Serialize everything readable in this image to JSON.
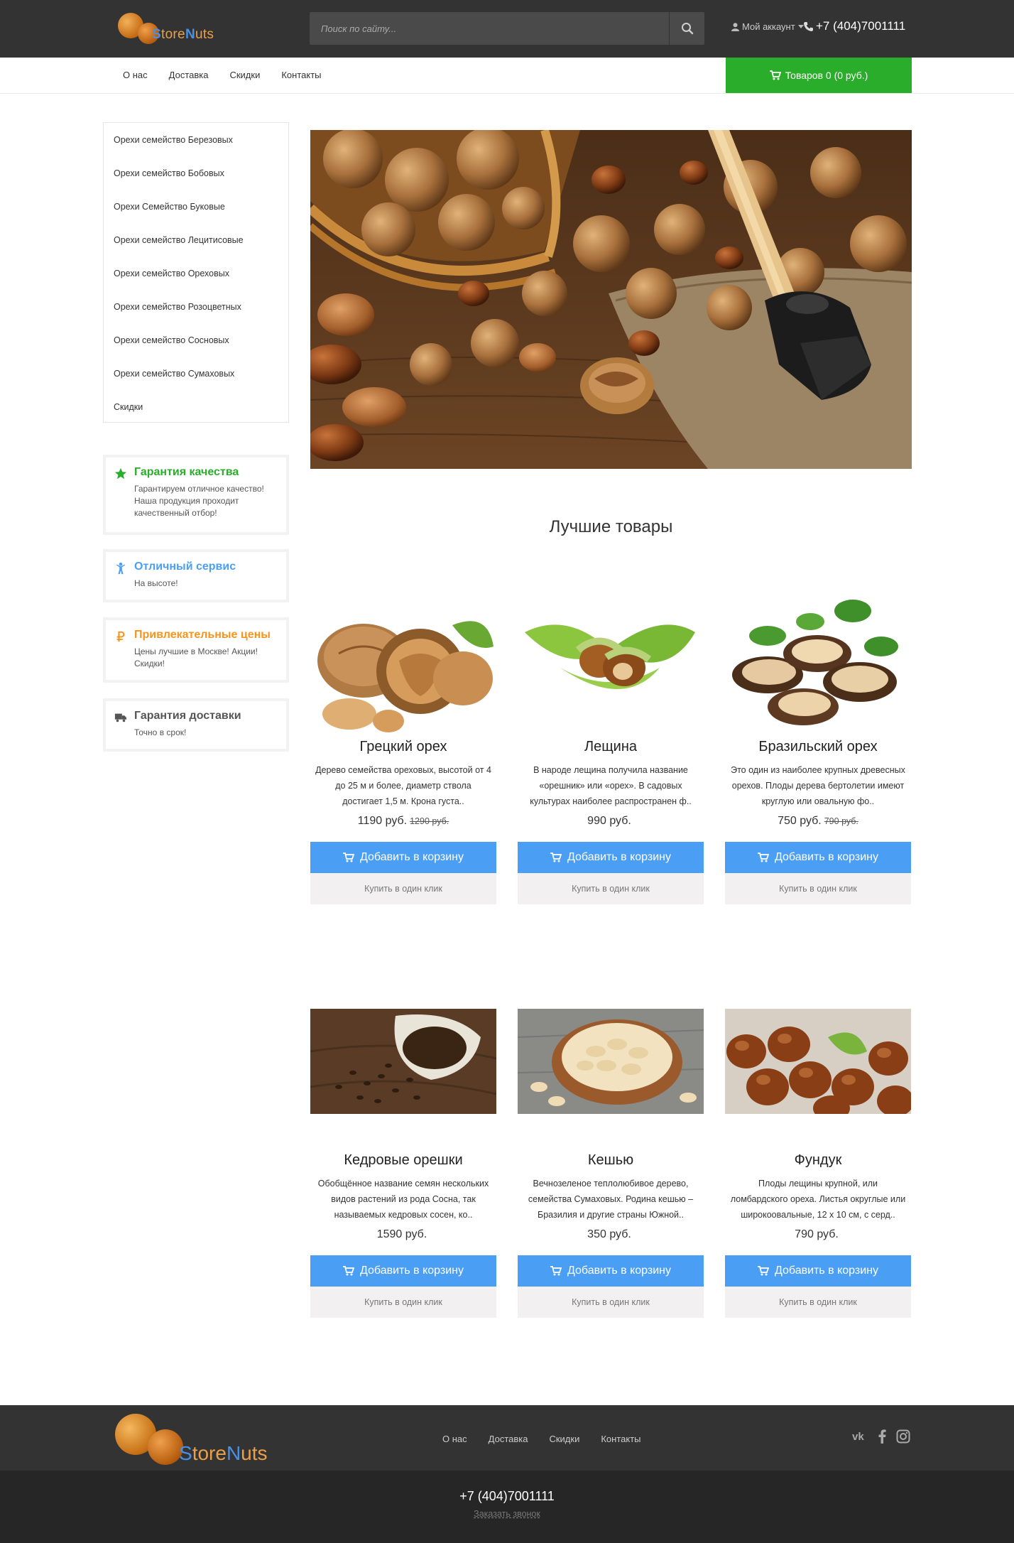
{
  "header": {
    "logo_text_start": "S",
    "logo_text_mid": "tore",
    "logo_text_n": "N",
    "logo_text_end": "uts",
    "search_placeholder": "Поиск по сайту...",
    "account_label": "Мой аккаунт",
    "phone": "+7 (404)7001111"
  },
  "nav": {
    "links": [
      "О нас",
      "Доставка",
      "Скидки",
      "Контакты"
    ],
    "cart_label": "Товаров 0 (0 руб.)"
  },
  "sidebar": {
    "categories": [
      "Орехи семейство Березовых",
      "Орехи семейство Бобовых",
      "Орехи Семейство Буковые",
      "Орехи семейство Лецитисовые",
      "Орехи семейство Ореховых",
      "Орехи семейство Розоцветных",
      "Орехи семейство Сосновых",
      "Орехи семейство Сумаховых",
      "Скидки"
    ],
    "features": [
      {
        "title": "Гарантия качества",
        "text": "Гарантируем отличное качество! Наша продукция проходит качественный отбор!",
        "color": "#2aad2a",
        "icon": "star-icon"
      },
      {
        "title": "Отличный сервис",
        "text": "На высоте!",
        "color": "#4a9ff5",
        "icon": "person-icon"
      },
      {
        "title": "Привлекательные цены",
        "text": "Цены лучшие в Москве! Акции! Скидки!",
        "color": "#f7941d",
        "icon": "ruble-icon"
      },
      {
        "title": "Гарантия доставки",
        "text": "Точно в срок!",
        "color": "#555555",
        "icon": "truck-icon"
      }
    ]
  },
  "main": {
    "section_title": "Лучшие товары",
    "add_to_cart_label": "Добавить в корзину",
    "one_click_label": "Купить в один клик",
    "products": [
      {
        "name": "Грецкий орех",
        "desc": "Дерево семейства ореховых, высотой от 4 до 25 м и более, диаметр ствола достигает 1,5 м. Крона густа..",
        "price": "1190 руб.",
        "old_price": "1290 руб.",
        "image": "walnut-image"
      },
      {
        "name": "Лещина",
        "desc": "В народе лещина получила название «орешник» или «орех». В садовых культурах наиболее распространен ф..",
        "price": "990 руб.",
        "old_price": "",
        "image": "hazel-image"
      },
      {
        "name": "Бразильский орех",
        "desc": "Это один из наиболее крупных древесных орехов. Плоды дерева бертолетии имеют круглую или овальную фо..",
        "price": "750 руб.",
        "old_price": "790 руб.",
        "image": "brazil-nut-image"
      },
      {
        "name": "Кедровые орешки",
        "desc": "Обобщённое название семян нескольких видов растений из рода Сосна, так называемых кедровых сосен, ко..",
        "price": "1590 руб.",
        "old_price": "",
        "image": "pine-nuts-image"
      },
      {
        "name": "Кешью",
        "desc": "Вечнозеленое теплолюбивое дерево, семейства Сумаховых. Родина кешью – Бразилия и другие страны Южной..",
        "price": "350 руб.",
        "old_price": "",
        "image": "cashew-image"
      },
      {
        "name": "Фундук",
        "desc": "Плоды лещины крупной, или ломбардского ореха. Листья округлые или широкоовальные, 12 х 10 см, с серд..",
        "price": "790 руб.",
        "old_price": "",
        "image": "hazelnut-image"
      }
    ]
  },
  "footer": {
    "links": [
      "О нас",
      "Доставка",
      "Скидки",
      "Контакты"
    ],
    "social": [
      "vk-icon",
      "facebook-icon",
      "instagram-icon"
    ],
    "phone": "+7 (404)7001111",
    "callback_label": "Заказать звонок"
  },
  "colors": {
    "topbar": "#333333",
    "cart_green": "#2aad2a",
    "button_blue": "#4a9ff5",
    "footer_dark": "#262626"
  }
}
